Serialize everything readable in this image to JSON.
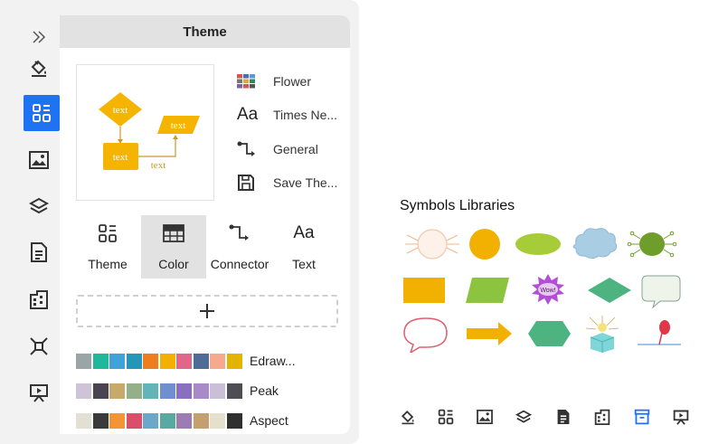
{
  "panel": {
    "title": "Theme",
    "sidebar": {
      "items": [
        {
          "name": "expand",
          "icon": "double-chevron-right-icon"
        },
        {
          "name": "fill",
          "icon": "paint-bucket-icon"
        },
        {
          "name": "theme",
          "icon": "theme-grid-icon",
          "active": true
        },
        {
          "name": "image",
          "icon": "image-icon"
        },
        {
          "name": "layers",
          "icon": "layers-icon"
        },
        {
          "name": "page",
          "icon": "document-icon"
        },
        {
          "name": "organize",
          "icon": "organize-icon"
        },
        {
          "name": "connect",
          "icon": "connect-icon"
        },
        {
          "name": "presentation",
          "icon": "presentation-icon"
        }
      ]
    },
    "preview": {
      "node_label": "text",
      "connector_label": "text",
      "accent_color": "#f5b400"
    },
    "properties": [
      {
        "icon": "color-grid-icon",
        "label": "Flower"
      },
      {
        "icon": "font-aa-icon",
        "label": "Times Ne..."
      },
      {
        "icon": "connector-icon",
        "label": "General"
      },
      {
        "icon": "save-icon",
        "label": "Save The..."
      }
    ],
    "tabs": [
      {
        "icon": "theme-grid-icon",
        "label": "Theme"
      },
      {
        "icon": "color-table-icon",
        "label": "Color",
        "active": true
      },
      {
        "icon": "connector-icon",
        "label": "Connector"
      },
      {
        "icon": "font-aa-icon",
        "label": "Text"
      }
    ],
    "add_icon": "plus-icon",
    "palettes": [
      {
        "name": "Edraw...",
        "colors": [
          "#9aa5a6",
          "#1fb89a",
          "#3fa2d9",
          "#2496b8",
          "#ef7d1f",
          "#f2b000",
          "#e0668a",
          "#4d6c96",
          "#f7a98f",
          "#e2b400"
        ]
      },
      {
        "name": "Peak",
        "colors": [
          "#cfc3d8",
          "#4a4450",
          "#c7a96b",
          "#93b08a",
          "#64b3b8",
          "#6f8fcf",
          "#8a6fc1",
          "#a88ac9",
          "#c9bfd6",
          "#4e4e54"
        ]
      },
      {
        "name": "Aspect",
        "colors": [
          "#e3dfd3",
          "#3a3a3a",
          "#f39436",
          "#d94f6b",
          "#6aa7c9",
          "#58a9a1",
          "#9c7cb1",
          "#c4a070",
          "#e5dfcd",
          "#2f2f2f"
        ]
      }
    ]
  },
  "symbols": {
    "title": "Symbols Libraries",
    "wow_text": "Wow!"
  },
  "bottom_toolbar": [
    {
      "icon": "paint-bucket-icon"
    },
    {
      "icon": "theme-grid-icon"
    },
    {
      "icon": "image-icon"
    },
    {
      "icon": "layers-icon"
    },
    {
      "icon": "document-icon"
    },
    {
      "icon": "organize-icon"
    },
    {
      "icon": "library-icon",
      "active": true
    },
    {
      "icon": "presentation-icon"
    }
  ],
  "colors": {
    "active_blue": "#1f73f2",
    "panel_bg": "#f2f2f2",
    "header_bg": "#e2e2e2"
  }
}
